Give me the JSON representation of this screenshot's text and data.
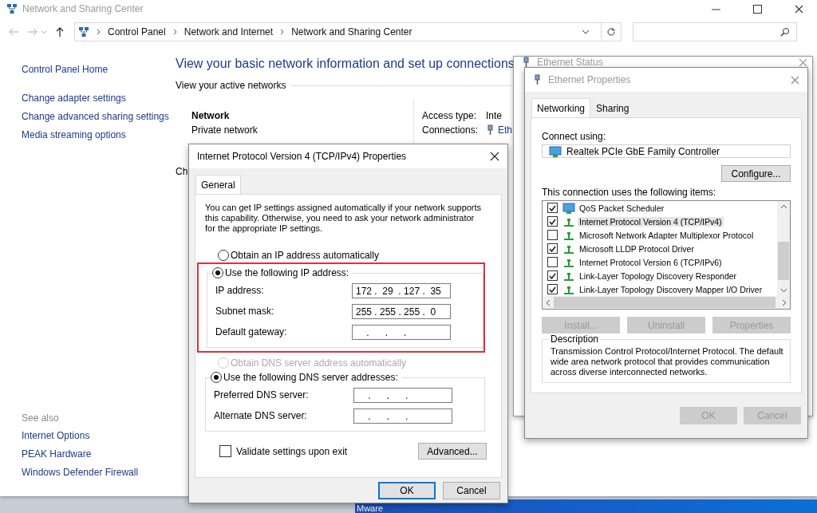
{
  "main_window": {
    "title": "Network and Sharing Center",
    "breadcrumb": [
      "Control Panel",
      "Network and Internet",
      "Network and Sharing Center"
    ],
    "sidebar": {
      "items": [
        "Control Panel Home",
        "Change adapter settings",
        "Change advanced sharing settings",
        "Media streaming options"
      ],
      "see_also_heading": "See also",
      "see_also": [
        "Internet Options",
        "PEAK Hardware",
        "Windows Defender Firewall"
      ]
    },
    "heading": "View your basic network information and set up connections",
    "section": "View your active networks",
    "network": {
      "name": "Network",
      "type": "Private network"
    },
    "access_type_label": "Access type:",
    "access_type_value": "Inte",
    "connections_label": "Connections:",
    "connections_value": "Eth",
    "cut_text": "Ch"
  },
  "ethernet_status": {
    "title": "Ethernet Status"
  },
  "ethernet_properties": {
    "title": "Ethernet Properties",
    "tabs": [
      {
        "label": "Networking",
        "selected": true
      },
      {
        "label": "Sharing",
        "selected": false
      }
    ],
    "connect_using_label": "Connect using:",
    "adapter": "Realtek PCIe GbE Family Controller",
    "configure_button": "Configure...",
    "items_label": "This connection uses the following items:",
    "items": [
      {
        "label": "QoS Packet Scheduler",
        "kind": "service",
        "checked": true,
        "selected": false
      },
      {
        "label": "Internet Protocol Version 4 (TCP/IPv4)",
        "kind": "protocol",
        "checked": true,
        "selected": true
      },
      {
        "label": "Microsoft Network Adapter Multiplexor Protocol",
        "kind": "protocol",
        "checked": false,
        "selected": false
      },
      {
        "label": "Microsoft LLDP Protocol Driver",
        "kind": "protocol",
        "checked": true,
        "selected": false
      },
      {
        "label": "Internet Protocol Version 6 (TCP/IPv6)",
        "kind": "protocol",
        "checked": false,
        "selected": false
      },
      {
        "label": "Link-Layer Topology Discovery Responder",
        "kind": "protocol",
        "checked": true,
        "selected": false
      },
      {
        "label": "Link-Layer Topology Discovery Mapper I/O Driver",
        "kind": "protocol",
        "checked": true,
        "selected": false
      }
    ],
    "item_buttons": [
      {
        "label": "Install...",
        "disabled": true
      },
      {
        "label": "Uninstall",
        "disabled": true
      },
      {
        "label": "Properties",
        "disabled": true
      }
    ],
    "description_heading": "Description",
    "description": "Transmission Control Protocol/Internet Protocol. The default wide area network protocol that provides communication across diverse interconnected networks.",
    "buttons": [
      {
        "label": "OK",
        "disabled": true
      },
      {
        "label": "Cancel",
        "disabled": true
      }
    ]
  },
  "ipv4_dialog": {
    "title": "Internet Protocol Version 4 (TCP/IPv4) Properties",
    "tabs": [
      {
        "label": "General",
        "selected": true
      }
    ],
    "intro": "You can get IP settings assigned automatically if your network supports this capability. Otherwise, you need to ask your network administrator for the appropriate IP settings.",
    "ip_auto": {
      "label": "Obtain an IP address automatically",
      "selected": false,
      "disabled": false
    },
    "ip_manual": {
      "label": "Use the following IP address:",
      "selected": true,
      "disabled": false,
      "highlighted": true,
      "fields": [
        {
          "label": "IP address:",
          "value": "172 .  29  . 127 .  35"
        },
        {
          "label": "Subnet mask:",
          "value": "255 . 255 . 255 .  0"
        },
        {
          "label": "Default gateway:",
          "value": "    .      .      .   "
        }
      ]
    },
    "dns_auto": {
      "label": "Obtain DNS server address automatically",
      "selected": false,
      "disabled": true
    },
    "dns_manual": {
      "label": "Use the following DNS server addresses:",
      "selected": true,
      "disabled": false,
      "fields": [
        {
          "label": "Preferred DNS server:",
          "value": "    .      .      .   "
        },
        {
          "label": "Alternate DNS server:",
          "value": "    .      .      .   "
        }
      ]
    },
    "validate": {
      "label": "Validate settings upon exit",
      "checked": false
    },
    "advanced_button": "Advanced...",
    "buttons": [
      {
        "label": "OK",
        "default": true
      },
      {
        "label": "Cancel",
        "default": false
      }
    ]
  },
  "desktop": {
    "taskbar_label": "Mware"
  }
}
